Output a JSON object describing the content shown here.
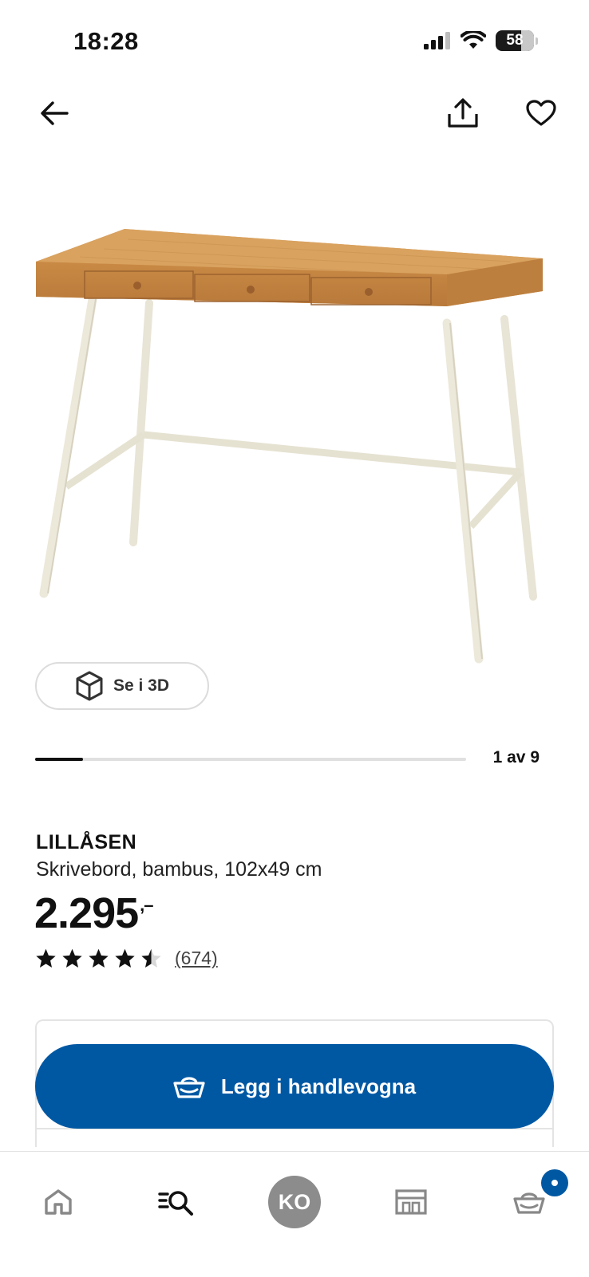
{
  "status_bar": {
    "time": "18:28",
    "battery": "58"
  },
  "top_actions": {
    "icons": [
      "back-arrow-icon",
      "share-icon",
      "heart-icon"
    ]
  },
  "gallery": {
    "view_3d_label": "Se i 3D",
    "counter": "1 av 9",
    "current": 1,
    "total": 9
  },
  "product": {
    "name": "LILLÅSEN",
    "description": "Skrivebord, bambus, 102x49 cm",
    "price": "2.295",
    "price_suffix": ",–",
    "rating": 4.5,
    "review_count": "(674)"
  },
  "cart_button": {
    "label": "Legg i handlevogna"
  },
  "bottom_nav": {
    "items": [
      "home-icon",
      "search-icon",
      "profile-avatar",
      "store-icon",
      "cart-icon"
    ],
    "avatar_initials": "KO"
  },
  "colors": {
    "accent": "#0058a3",
    "avatar_bg": "#8c8c8c"
  }
}
